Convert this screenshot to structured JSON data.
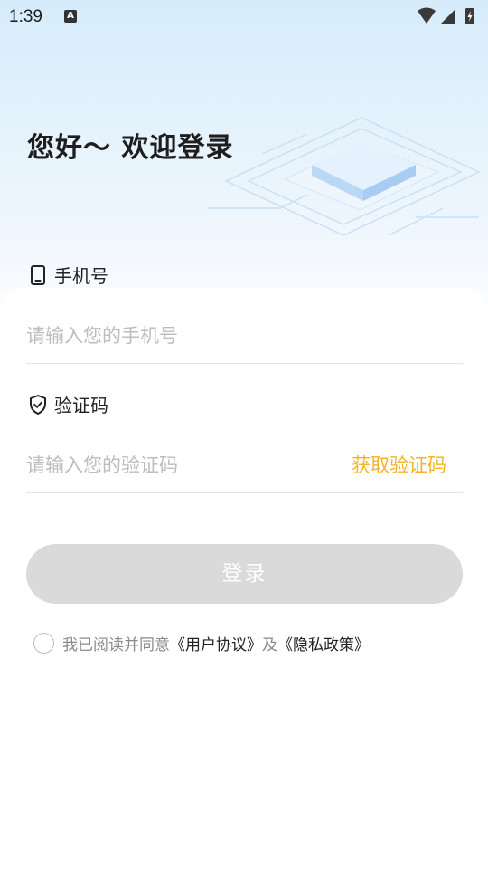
{
  "status_bar": {
    "time": "1:39",
    "notification_icon_letter": "A",
    "icons": [
      "wifi-icon",
      "signal-icon",
      "battery-charging-icon"
    ]
  },
  "header": {
    "greeting": "您好～ 欢迎登录"
  },
  "phone": {
    "label": "手机号",
    "icon": "mobile-phone-icon",
    "placeholder": "请输入您的手机号",
    "value": ""
  },
  "code": {
    "label": "验证码",
    "icon": "shield-check-icon",
    "placeholder": "请输入您的验证码",
    "value": "",
    "get_code_label": "获取验证码"
  },
  "login_button": {
    "label": "登录"
  },
  "agreement": {
    "checked": false,
    "prefix": "我已阅读并同意",
    "user_agreement": "《用户协议》",
    "and": "及",
    "privacy_policy": "《隐私政策》"
  },
  "colors": {
    "accent": "#f5b42a",
    "button_disabled": "#dadada",
    "hero_top": "#d6ecfb"
  }
}
